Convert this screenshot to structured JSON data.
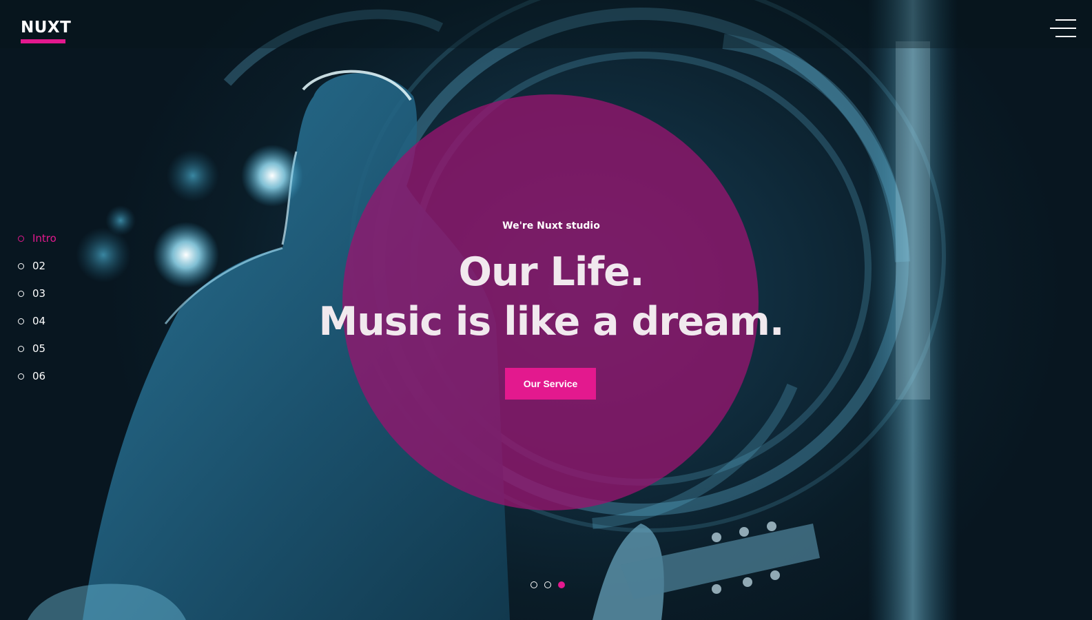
{
  "brand": {
    "logo_text": "NUXT",
    "accent_color": "#e3198e"
  },
  "header": {
    "menu_icon": "hamburger-menu-icon"
  },
  "side_nav": {
    "items": [
      {
        "label": "Intro",
        "active": true
      },
      {
        "label": "02",
        "active": false
      },
      {
        "label": "03",
        "active": false
      },
      {
        "label": "04",
        "active": false
      },
      {
        "label": "05",
        "active": false
      },
      {
        "label": "06",
        "active": false
      }
    ]
  },
  "hero": {
    "kicker": "We're Nuxt studio",
    "headline_line1": "Our Life.",
    "headline_line2": "Music is like a dream.",
    "cta_label": "Our Service",
    "background_image": "guitarist-concert-photo"
  },
  "slider": {
    "slide_count": 3,
    "active_index": 2
  }
}
